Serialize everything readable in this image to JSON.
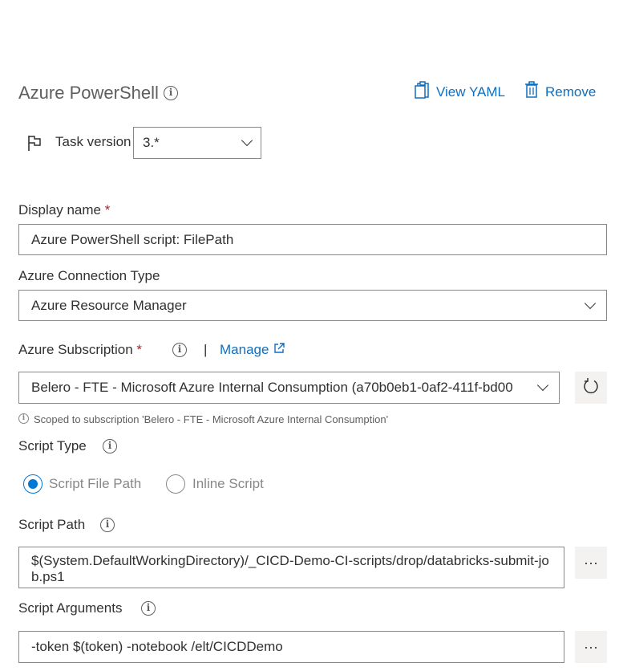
{
  "header": {
    "title": "Azure PowerShell",
    "view_yaml_label": "View YAML",
    "remove_label": "Remove"
  },
  "task_version": {
    "label": "Task version",
    "value": "3.*"
  },
  "display_name": {
    "label": "Display name",
    "required_mark": "*",
    "value": "Azure PowerShell script: FilePath"
  },
  "connection_type": {
    "label": "Azure Connection Type",
    "value": "Azure Resource Manager"
  },
  "subscription": {
    "label": "Azure Subscription",
    "required_mark": "*",
    "separator": "|",
    "manage_label": "Manage",
    "value": "Belero - FTE - Microsoft Azure Internal Consumption (a70b0eb1-0af2-411f-bd00",
    "scope_note": "Scoped to subscription 'Belero - FTE - Microsoft Azure Internal Consumption'"
  },
  "script_type": {
    "label": "Script Type",
    "options": [
      {
        "label": "Script File Path",
        "selected": true
      },
      {
        "label": "Inline Script",
        "selected": false
      }
    ]
  },
  "script_path": {
    "label": "Script Path",
    "value": "$(System.DefaultWorkingDirectory)/_CICD-Demo-CI-scripts/drop/databricks-submit-job.ps1"
  },
  "script_arguments": {
    "label": "Script Arguments",
    "value": "-token $(token) -notebook /elt/CICDDemo"
  },
  "more_label": "···",
  "colors": {
    "link": "#106ebe",
    "accent": "#0078d4",
    "required": "#a4262c",
    "text": "#323130",
    "muted": "#605e5c"
  }
}
